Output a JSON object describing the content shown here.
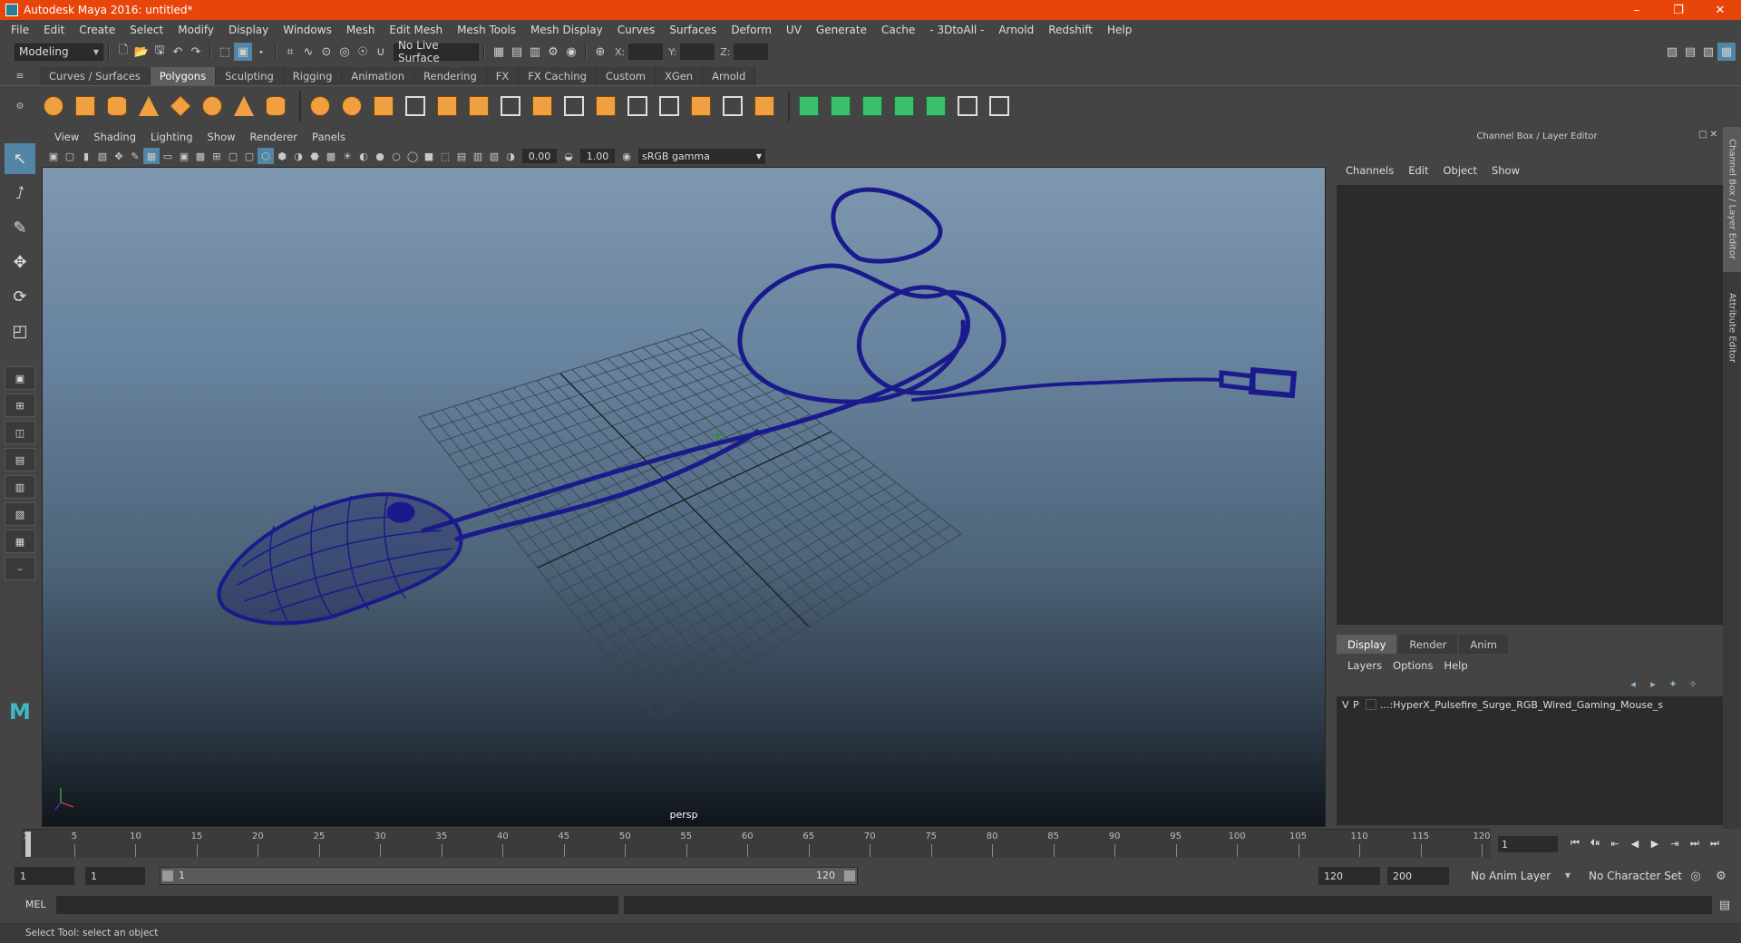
{
  "window": {
    "title": "Autodesk Maya 2016: untitled*"
  },
  "menu": [
    "File",
    "Edit",
    "Create",
    "Select",
    "Modify",
    "Display",
    "Windows",
    "Mesh",
    "Edit Mesh",
    "Mesh Tools",
    "Mesh Display",
    "Curves",
    "Surfaces",
    "Deform",
    "UV",
    "Generate",
    "Cache",
    "- 3DtoAll -",
    "Arnold",
    "Redshift",
    "Help"
  ],
  "status_line": {
    "mode": "Modeling",
    "live_surface": "No Live Surface",
    "x_label": "X:",
    "y_label": "Y:",
    "z_label": "Z:"
  },
  "shelf_tabs": [
    "Curves / Surfaces",
    "Polygons",
    "Sculpting",
    "Rigging",
    "Animation",
    "Rendering",
    "FX",
    "FX Caching",
    "Custom",
    "XGen",
    "Arnold"
  ],
  "active_shelf_tab": "Polygons",
  "viewport": {
    "menu": [
      "View",
      "Shading",
      "Lighting",
      "Show",
      "Renderer",
      "Panels"
    ],
    "exposure": "0.00",
    "gamma": "1.00",
    "color_space": "sRGB gamma",
    "camera": "persp"
  },
  "channel_box": {
    "title": "Channel Box / Layer Editor",
    "menu": [
      "Channels",
      "Edit",
      "Object",
      "Show"
    ],
    "side_tabs": [
      "Channel Box / Layer Editor",
      "Attribute Editor"
    ]
  },
  "layer_editor": {
    "tabs": [
      "Display",
      "Render",
      "Anim"
    ],
    "active_tab": "Display",
    "menu": [
      "Layers",
      "Options",
      "Help"
    ],
    "layers": [
      {
        "v": "V",
        "p": "P",
        "name": "...:HyperX_Pulsefire_Surge_RGB_Wired_Gaming_Mouse_s"
      }
    ]
  },
  "time_slider": {
    "ticks": [
      "5",
      "10",
      "15",
      "20",
      "25",
      "30",
      "35",
      "40",
      "45",
      "50",
      "55",
      "60",
      "65",
      "70",
      "75",
      "80",
      "85",
      "90",
      "95",
      "100",
      "105",
      "110",
      "115",
      "120"
    ],
    "start_label": "1",
    "current_frame": "1"
  },
  "range_slider": {
    "start": "1",
    "playback_start": "1",
    "range_lo": "1",
    "range_hi": "120",
    "playback_end": "120",
    "end": "200",
    "anim_layer": "No Anim Layer",
    "character_set": "No Character Set"
  },
  "command_line": {
    "label": "MEL"
  },
  "help_line": "Select Tool: select an object",
  "colors": {
    "title_bar": "#e8450a",
    "active_tab": "#5285a6",
    "wireframe": "#1a1a8c",
    "shelf_icon": "#f0a040"
  }
}
